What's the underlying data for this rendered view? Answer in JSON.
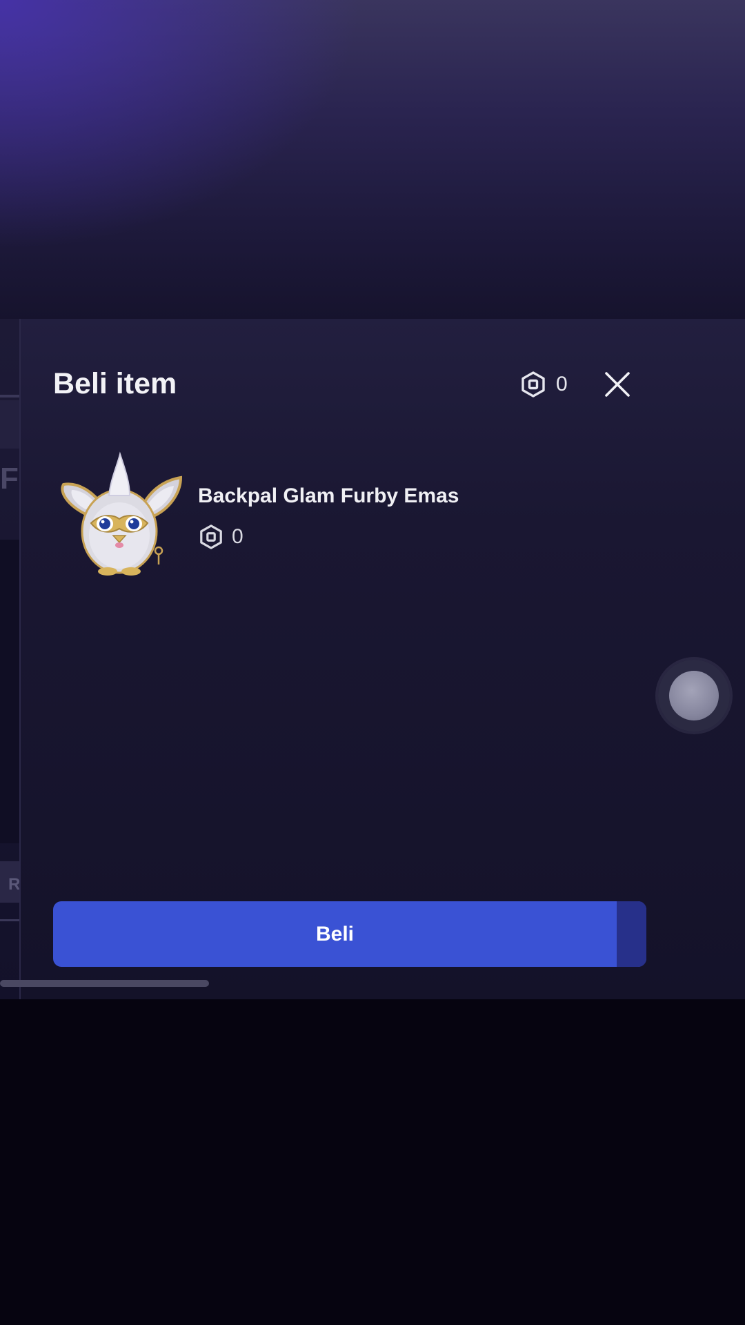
{
  "dialog": {
    "title": "Beli item",
    "balance": "0",
    "close_icon": "close-icon"
  },
  "item": {
    "name": "Backpal Glam Furby Emas",
    "price": "0",
    "thumbnail": "furby-thumbnail",
    "currency_icon": "robux-icon"
  },
  "actions": {
    "buy_label": "Beli"
  },
  "background_fragments": {
    "left_glyph": "F",
    "left_glyph_2": "R"
  },
  "colors": {
    "accent": "#3a52d4",
    "panel": "#1a1732"
  }
}
